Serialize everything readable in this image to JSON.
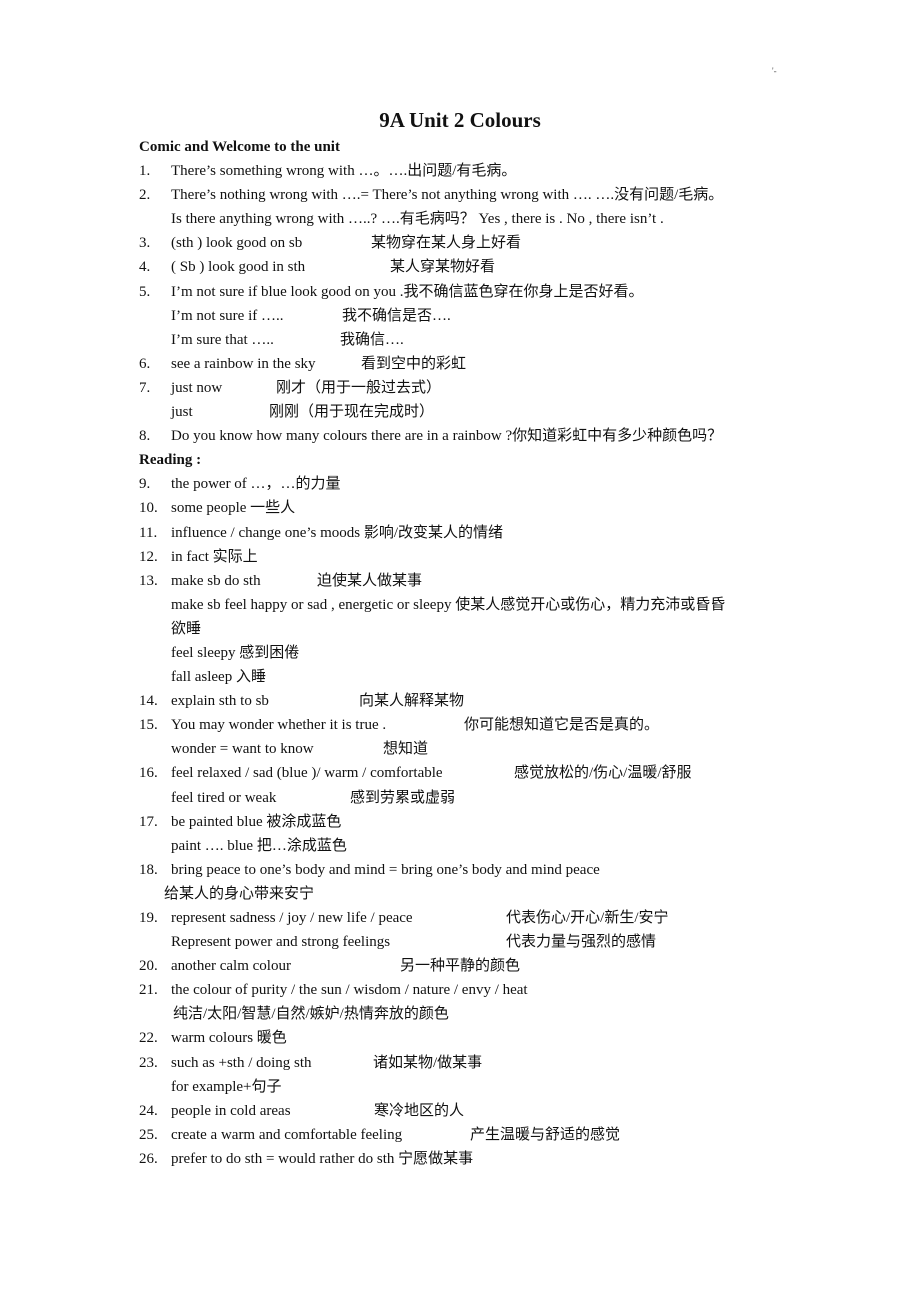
{
  "page_mark": "'-",
  "title": "9A Unit 2 Colours",
  "sections": {
    "comic": "Comic and Welcome to the unit",
    "reading": "Reading :"
  },
  "lines": [
    {
      "num": "1.",
      "en": "There’s something wrong with …。….出问题/有毛病。",
      "zh": ""
    },
    {
      "num": "2.",
      "en": "There’s nothing wrong with ….= There’s not anything wrong with …. ….没有问题/毛病。",
      "zh": ""
    },
    {
      "num": "",
      "en": "Is there anything wrong with …..? ….有毛病吗？ Yes , there is . No , there isn’t .",
      "zh": ""
    },
    {
      "num": "3.",
      "en": "(sth ) look good on sb",
      "zh": "某物穿在某人身上好看"
    },
    {
      "num": "4.",
      "en": "( Sb ) look good in sth",
      "zh": "某人穿某物好看"
    },
    {
      "num": "5.",
      "en": "I’m not sure if blue look good on you .我不确信蓝色穿在你身上是否好看。",
      "zh": ""
    },
    {
      "num": "",
      "en": "I’m not sure if …..",
      "zh": "我不确信是否…."
    },
    {
      "num": "",
      "en": "I’m sure that …..",
      "zh": "我确信…."
    },
    {
      "num": "6.",
      "en": "see a rainbow in the sky",
      "zh": "看到空中的彩虹"
    },
    {
      "num": "7.",
      "en": "just now",
      "zh": "刚才（用于一般过去式）"
    },
    {
      "num": "",
      "en": "just",
      "zh": "刚刚（用于现在完成时）"
    },
    {
      "num": "8.",
      "en": "Do you know how many colours there are in a rainbow ?你知道彩虹中有多少种颜色吗？",
      "zh": ""
    },
    {
      "num": "9.",
      "en": "the power of …，…的力量",
      "zh": ""
    },
    {
      "num": "10.",
      "en": "some people  一些人",
      "zh": ""
    },
    {
      "num": "11.",
      "en": "influence / change one’s moods 影响/改变某人的情绪",
      "zh": ""
    },
    {
      "num": "12.",
      "en": "in fact  实际上",
      "zh": ""
    },
    {
      "num": "13.",
      "en": "make sb do sth",
      "zh": "迫使某人做某事"
    },
    {
      "num": "",
      "en": "make sb feel happy or sad , energetic or sleepy  使某人感觉开心或伤心，精力充沛或昏昏",
      "zh": ""
    },
    {
      "num": "",
      "en": "欲睡",
      "zh": ""
    },
    {
      "num": "",
      "en": "feel sleepy  感到困倦",
      "zh": ""
    },
    {
      "num": "",
      "en": "fall asleep  入睡",
      "zh": ""
    },
    {
      "num": "14.",
      "en": "explain sth to sb",
      "zh": "向某人解释某物"
    },
    {
      "num": "15.",
      "en": "You may wonder whether it is true .",
      "zh": "你可能想知道它是否是真的。"
    },
    {
      "num": "",
      "en": "wonder = want to know",
      "zh": "想知道"
    },
    {
      "num": "16.",
      "en": "feel relaxed / sad (blue )/ warm / comfortable",
      "zh": "感觉放松的/伤心/温暖/舒服"
    },
    {
      "num": "",
      "en": "feel tired or weak",
      "zh": "感到劳累或虚弱"
    },
    {
      "num": "17.",
      "en": "be painted blue  被涂成蓝色",
      "zh": ""
    },
    {
      "num": "",
      "en": "paint …. blue  把…涂成蓝色",
      "zh": ""
    },
    {
      "num": "18.",
      "en": "bring peace to one’s body and mind = bring one’s body and mind peace",
      "zh": ""
    },
    {
      "num": "",
      "en": "给某人的身心带来安宁",
      "zh": ""
    },
    {
      "num": "19.",
      "en": "represent sadness / joy / new life / peace",
      "zh": "代表伤心/开心/新生/安宁"
    },
    {
      "num": "",
      "en": "Represent power and strong feelings",
      "zh": "代表力量与强烈的感情"
    },
    {
      "num": "20.",
      "en": "another calm colour",
      "zh": "另一种平静的颜色"
    },
    {
      "num": "21.",
      "en": "the colour of purity / the sun / wisdom / nature / envy / heat",
      "zh": ""
    },
    {
      "num": "",
      "en": "纯洁/太阳/智慧/自然/嫉妒/热情奔放的颜色",
      "zh": ""
    },
    {
      "num": "22.",
      "en": "warm colours 暖色",
      "zh": ""
    },
    {
      "num": "23.",
      "en": "such as +sth / doing sth",
      "zh": "诸如某物/做某事"
    },
    {
      "num": "",
      "en": "for example+句子",
      "zh": ""
    },
    {
      "num": "24.",
      "en": "people in cold areas",
      "zh": "寒冷地区的人"
    },
    {
      "num": "25.",
      "en": "create a warm and comfortable feeling",
      "zh": "产生温暖与舒适的感觉"
    },
    {
      "num": "26.",
      "en": "prefer to do sth = would rather do sth  宁愿做某事",
      "zh": ""
    }
  ]
}
